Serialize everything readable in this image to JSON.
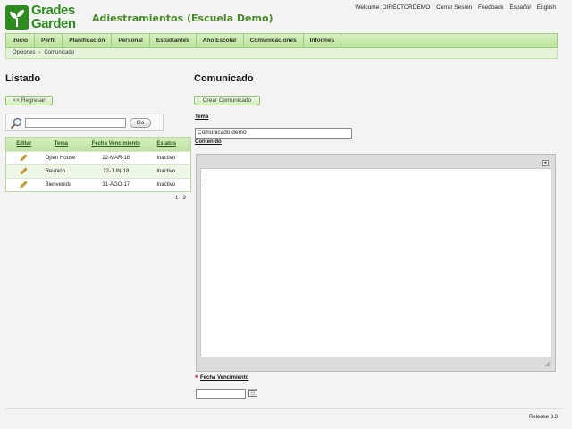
{
  "brand": {
    "line1": "Grades",
    "line2": "Garden",
    "color": "#2e8b1f"
  },
  "app_title": "Adiestramientos (Escuela Demo)",
  "top_links": {
    "welcome": "Welcome: DIRECTORDEMO",
    "logout": "Cerrar Sesión",
    "feedback": "Feedback",
    "spanish": "Español",
    "english": "English"
  },
  "nav": {
    "items": [
      {
        "label": "Inicio"
      },
      {
        "label": "Perfil"
      },
      {
        "label": "Planificación"
      },
      {
        "label": "Personal"
      },
      {
        "label": "Estudiantes"
      },
      {
        "label": "Año Escolar"
      },
      {
        "label": "Comunicaciones"
      },
      {
        "label": "Informes"
      }
    ]
  },
  "breadcrumb": {
    "first": "Opciones",
    "separator": "›",
    "current": "Comunicado"
  },
  "left": {
    "title": "Listado",
    "back_button": "<< Regresar",
    "search": {
      "value": "",
      "go_label": "Go"
    },
    "table": {
      "headers": {
        "edit": "Editar",
        "tema": "Tema",
        "fecha": "Fecha Vencimiento",
        "estatus": "Estatus"
      },
      "rows": [
        {
          "tema": "Open House",
          "fecha": "22-MAR-18",
          "estatus": "Inactivo"
        },
        {
          "tema": "Reunión",
          "fecha": "22-JUN-18",
          "estatus": "Inactivo"
        },
        {
          "tema": "Bienvenida",
          "fecha": "31-AGO-17",
          "estatus": "Inactivo"
        }
      ]
    },
    "pager": "1 - 3"
  },
  "right": {
    "title": "Comunicado",
    "create_button": "Crear Comunicado",
    "tema_label": "Tema",
    "tema_value": "Comunicado demo",
    "contenido_label": "Contenido",
    "editor_collapse": "◂",
    "fecha_label": "Fecha Vencimiento",
    "required_mark": "*",
    "fecha_value": ""
  },
  "footer": {
    "release": "Release 3.3"
  },
  "icons": {
    "search": "magnifier-icon",
    "edit": "pencil-icon",
    "calendar": "calendar-icon"
  }
}
